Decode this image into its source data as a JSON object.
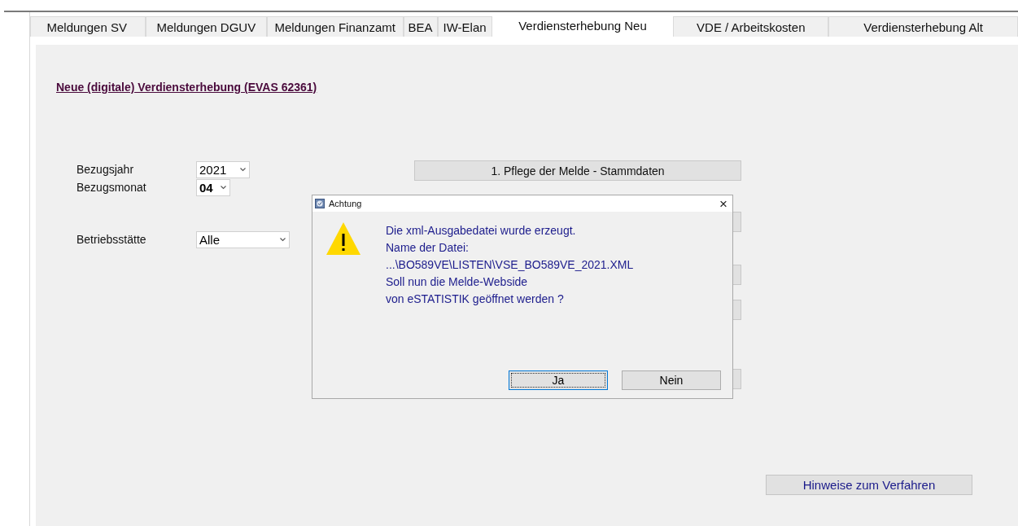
{
  "tabs": [
    {
      "label": "Meldungen SV",
      "selected": false
    },
    {
      "label": "Meldungen DGUV",
      "selected": false
    },
    {
      "label": "Meldungen Finanzamt",
      "selected": false
    },
    {
      "label": "BEA",
      "selected": false
    },
    {
      "label": "IW-Elan",
      "selected": false
    },
    {
      "label": "Verdiensterhebung Neu",
      "selected": true
    },
    {
      "label": "VDE / Arbeitskosten",
      "selected": false
    },
    {
      "label": "Verdiensterhebung Alt",
      "selected": false
    }
  ],
  "heading": "Neue (digitale) Verdiensterhebung (EVAS 62361)",
  "form": [
    {
      "label": "Bezugsjahr",
      "value": "2021"
    },
    {
      "label": "Bezugsmonat",
      "value": "04"
    },
    {
      "label": "Betriebsstätte",
      "value": "Alle"
    }
  ],
  "actions": [
    {
      "label": "1. Pflege der Melde - Stammdaten"
    },
    {
      "kind": "covered"
    },
    {
      "kind": "covered"
    },
    {
      "kind": "covered"
    },
    {
      "kind": "covered"
    }
  ],
  "help_button": "Hinweise zum Verfahren",
  "dialog": {
    "title": "Achtung",
    "close": "×",
    "message": [
      "Die xml-Ausgabedatei wurde erzeugt.",
      "Name der Datei:",
      "...\\BO589VE\\LISTEN\\VSE_BO589VE_2021.XML",
      "Soll nun die Melde-Webside",
      "von eSTATISTIK geöffnet werden ?"
    ],
    "buttons": [
      {
        "label": "Ja",
        "selected": true
      },
      {
        "label": "Nein",
        "selected": false
      }
    ]
  }
}
